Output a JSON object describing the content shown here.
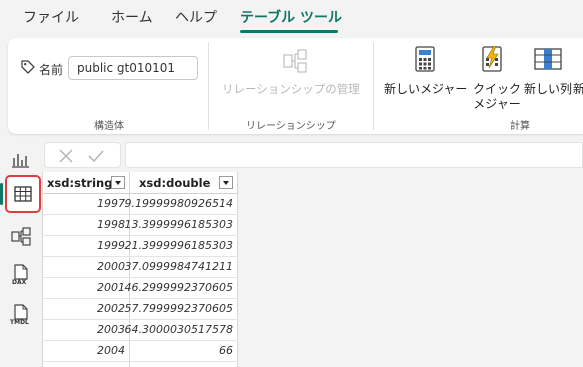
{
  "menu": {
    "tabs": [
      {
        "label": "ファイル"
      },
      {
        "label": "ホーム"
      },
      {
        "label": "ヘルプ"
      },
      {
        "label": "テーブル ツール"
      }
    ],
    "active_tab": "テーブル ツール"
  },
  "ribbon": {
    "structure_group": {
      "name_label": "名前",
      "name_value": "public gt010101",
      "group_label": "構造体"
    },
    "relationship_group": {
      "manage_label": "リレーションシップの管理",
      "group_label": "リレーションシップ"
    },
    "calc_group": {
      "new_measure": "新しいメジャー",
      "quick_measure_line1": "クイック",
      "quick_measure_line2": "メジャー",
      "new_column": "新しい列",
      "new_table_truncated": "新",
      "group_label": "計算"
    }
  },
  "rail": {
    "items": [
      {
        "icon": "report-view-icon"
      },
      {
        "icon": "table-view-icon"
      },
      {
        "icon": "model-view-icon"
      },
      {
        "icon": "dax-query-icon",
        "text": "DAX"
      },
      {
        "icon": "tmdl-view-icon",
        "text": "TMDL"
      }
    ],
    "active": "table-view-icon"
  },
  "table": {
    "columns": [
      {
        "header": "xsd:string"
      },
      {
        "header": "xsd:double"
      }
    ],
    "rows": [
      [
        "1997",
        "9.19999980926514"
      ],
      [
        "1998",
        "13.3999996185303"
      ],
      [
        "1999",
        "21.3999996185303"
      ],
      [
        "2000",
        "37.0999984741211"
      ],
      [
        "2001",
        "46.2999992370605"
      ],
      [
        "2002",
        "57.7999992370605"
      ],
      [
        "2003",
        "64.3000030517578"
      ],
      [
        "2004",
        "66"
      ]
    ]
  },
  "colors": {
    "accent": "#117865",
    "highlight_border": "#e03e3e",
    "background": "#f3f3f3"
  }
}
